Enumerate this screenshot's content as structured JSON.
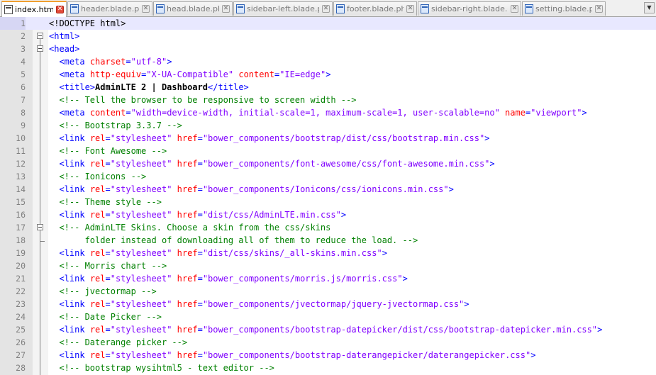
{
  "tabs": [
    {
      "label": "index.html",
      "active": true
    },
    {
      "label": "header.blade.php",
      "active": false
    },
    {
      "label": "head.blade.php",
      "active": false
    },
    {
      "label": "sidebar-left.blade.php",
      "active": false
    },
    {
      "label": "footer.blade.php",
      "active": false
    },
    {
      "label": "sidebar-right.blade.php",
      "active": false
    },
    {
      "label": "setting.blade.php",
      "active": false
    }
  ],
  "dropdown_icon": "chevron-down-icon",
  "colors": {
    "tag": "#0000ff",
    "attribute": "#ff0000",
    "value": "#8000ff",
    "comment": "#008000",
    "current_line": "#e8e8ff",
    "active_tab_accent": "#f0a030"
  },
  "editor": {
    "current_line": 1,
    "lines": [
      {
        "n": "1",
        "tokens": [
          [
            "doc",
            "<!DOCTYPE html>"
          ]
        ]
      },
      {
        "n": "2",
        "tokens": [
          [
            "tag",
            "<html>"
          ]
        ]
      },
      {
        "n": "3",
        "tokens": [
          [
            "tag",
            "<head>"
          ]
        ]
      },
      {
        "n": "4",
        "tokens": [
          [
            "pl",
            "  "
          ],
          [
            "tag",
            "<meta "
          ],
          [
            "attr",
            "charset"
          ],
          [
            "tag",
            "="
          ],
          [
            "val",
            "\"utf-8\""
          ],
          [
            "tag",
            ">"
          ]
        ]
      },
      {
        "n": "5",
        "tokens": [
          [
            "pl",
            "  "
          ],
          [
            "tag",
            "<meta "
          ],
          [
            "attr",
            "http-equiv"
          ],
          [
            "tag",
            "="
          ],
          [
            "val",
            "\"X-UA-Compatible\""
          ],
          [
            "tag",
            " "
          ],
          [
            "attr",
            "content"
          ],
          [
            "tag",
            "="
          ],
          [
            "val",
            "\"IE=edge\""
          ],
          [
            "tag",
            ">"
          ]
        ]
      },
      {
        "n": "6",
        "tokens": [
          [
            "pl",
            "  "
          ],
          [
            "tag",
            "<title>"
          ],
          [
            "txt",
            "AdminLTE 2 | Dashboard"
          ],
          [
            "tag",
            "</title>"
          ]
        ]
      },
      {
        "n": "7",
        "tokens": [
          [
            "pl",
            "  "
          ],
          [
            "com",
            "<!-- Tell the browser to be responsive to screen width -->"
          ]
        ]
      },
      {
        "n": "8",
        "tokens": [
          [
            "pl",
            "  "
          ],
          [
            "tag",
            "<meta "
          ],
          [
            "attr",
            "content"
          ],
          [
            "tag",
            "="
          ],
          [
            "val",
            "\"width=device-width, initial-scale=1, maximum-scale=1, user-scalable=no\""
          ],
          [
            "tag",
            " "
          ],
          [
            "attr",
            "name"
          ],
          [
            "tag",
            "="
          ],
          [
            "val",
            "\"viewport\""
          ],
          [
            "tag",
            ">"
          ]
        ]
      },
      {
        "n": "9",
        "tokens": [
          [
            "pl",
            "  "
          ],
          [
            "com",
            "<!-- Bootstrap 3.3.7 -->"
          ]
        ]
      },
      {
        "n": "10",
        "tokens": [
          [
            "pl",
            "  "
          ],
          [
            "tag",
            "<link "
          ],
          [
            "attr",
            "rel"
          ],
          [
            "tag",
            "="
          ],
          [
            "val",
            "\"stylesheet\""
          ],
          [
            "tag",
            " "
          ],
          [
            "attr",
            "href"
          ],
          [
            "tag",
            "="
          ],
          [
            "val",
            "\"bower_components/bootstrap/dist/css/bootstrap.min.css\""
          ],
          [
            "tag",
            ">"
          ]
        ]
      },
      {
        "n": "11",
        "tokens": [
          [
            "pl",
            "  "
          ],
          [
            "com",
            "<!-- Font Awesome -->"
          ]
        ]
      },
      {
        "n": "12",
        "tokens": [
          [
            "pl",
            "  "
          ],
          [
            "tag",
            "<link "
          ],
          [
            "attr",
            "rel"
          ],
          [
            "tag",
            "="
          ],
          [
            "val",
            "\"stylesheet\""
          ],
          [
            "tag",
            " "
          ],
          [
            "attr",
            "href"
          ],
          [
            "tag",
            "="
          ],
          [
            "val",
            "\"bower_components/font-awesome/css/font-awesome.min.css\""
          ],
          [
            "tag",
            ">"
          ]
        ]
      },
      {
        "n": "13",
        "tokens": [
          [
            "pl",
            "  "
          ],
          [
            "com",
            "<!-- Ionicons -->"
          ]
        ]
      },
      {
        "n": "14",
        "tokens": [
          [
            "pl",
            "  "
          ],
          [
            "tag",
            "<link "
          ],
          [
            "attr",
            "rel"
          ],
          [
            "tag",
            "="
          ],
          [
            "val",
            "\"stylesheet\""
          ],
          [
            "tag",
            " "
          ],
          [
            "attr",
            "href"
          ],
          [
            "tag",
            "="
          ],
          [
            "val",
            "\"bower_components/Ionicons/css/ionicons.min.css\""
          ],
          [
            "tag",
            ">"
          ]
        ]
      },
      {
        "n": "15",
        "tokens": [
          [
            "pl",
            "  "
          ],
          [
            "com",
            "<!-- Theme style -->"
          ]
        ]
      },
      {
        "n": "16",
        "tokens": [
          [
            "pl",
            "  "
          ],
          [
            "tag",
            "<link "
          ],
          [
            "attr",
            "rel"
          ],
          [
            "tag",
            "="
          ],
          [
            "val",
            "\"stylesheet\""
          ],
          [
            "tag",
            " "
          ],
          [
            "attr",
            "href"
          ],
          [
            "tag",
            "="
          ],
          [
            "val",
            "\"dist/css/AdminLTE.min.css\""
          ],
          [
            "tag",
            ">"
          ]
        ]
      },
      {
        "n": "17",
        "tokens": [
          [
            "pl",
            "  "
          ],
          [
            "com",
            "<!-- AdminLTE Skins. Choose a skin from the css/skins"
          ]
        ]
      },
      {
        "n": "18",
        "tokens": [
          [
            "com",
            "       folder instead of downloading all of them to reduce the load. -->"
          ]
        ]
      },
      {
        "n": "19",
        "tokens": [
          [
            "pl",
            "  "
          ],
          [
            "tag",
            "<link "
          ],
          [
            "attr",
            "rel"
          ],
          [
            "tag",
            "="
          ],
          [
            "val",
            "\"stylesheet\""
          ],
          [
            "tag",
            " "
          ],
          [
            "attr",
            "href"
          ],
          [
            "tag",
            "="
          ],
          [
            "val",
            "\"dist/css/skins/_all-skins.min.css\""
          ],
          [
            "tag",
            ">"
          ]
        ]
      },
      {
        "n": "20",
        "tokens": [
          [
            "pl",
            "  "
          ],
          [
            "com",
            "<!-- Morris chart -->"
          ]
        ]
      },
      {
        "n": "21",
        "tokens": [
          [
            "pl",
            "  "
          ],
          [
            "tag",
            "<link "
          ],
          [
            "attr",
            "rel"
          ],
          [
            "tag",
            "="
          ],
          [
            "val",
            "\"stylesheet\""
          ],
          [
            "tag",
            " "
          ],
          [
            "attr",
            "href"
          ],
          [
            "tag",
            "="
          ],
          [
            "val",
            "\"bower_components/morris.js/morris.css\""
          ],
          [
            "tag",
            ">"
          ]
        ]
      },
      {
        "n": "22",
        "tokens": [
          [
            "pl",
            "  "
          ],
          [
            "com",
            "<!-- jvectormap -->"
          ]
        ]
      },
      {
        "n": "23",
        "tokens": [
          [
            "pl",
            "  "
          ],
          [
            "tag",
            "<link "
          ],
          [
            "attr",
            "rel"
          ],
          [
            "tag",
            "="
          ],
          [
            "val",
            "\"stylesheet\""
          ],
          [
            "tag",
            " "
          ],
          [
            "attr",
            "href"
          ],
          [
            "tag",
            "="
          ],
          [
            "val",
            "\"bower_components/jvectormap/jquery-jvectormap.css\""
          ],
          [
            "tag",
            ">"
          ]
        ]
      },
      {
        "n": "24",
        "tokens": [
          [
            "pl",
            "  "
          ],
          [
            "com",
            "<!-- Date Picker -->"
          ]
        ]
      },
      {
        "n": "25",
        "tokens": [
          [
            "pl",
            "  "
          ],
          [
            "tag",
            "<link "
          ],
          [
            "attr",
            "rel"
          ],
          [
            "tag",
            "="
          ],
          [
            "val",
            "\"stylesheet\""
          ],
          [
            "tag",
            " "
          ],
          [
            "attr",
            "href"
          ],
          [
            "tag",
            "="
          ],
          [
            "val",
            "\"bower_components/bootstrap-datepicker/dist/css/bootstrap-datepicker.min.css\""
          ],
          [
            "tag",
            ">"
          ]
        ]
      },
      {
        "n": "26",
        "tokens": [
          [
            "pl",
            "  "
          ],
          [
            "com",
            "<!-- Daterange picker -->"
          ]
        ]
      },
      {
        "n": "27",
        "tokens": [
          [
            "pl",
            "  "
          ],
          [
            "tag",
            "<link "
          ],
          [
            "attr",
            "rel"
          ],
          [
            "tag",
            "="
          ],
          [
            "val",
            "\"stylesheet\""
          ],
          [
            "tag",
            " "
          ],
          [
            "attr",
            "href"
          ],
          [
            "tag",
            "="
          ],
          [
            "val",
            "\"bower_components/bootstrap-daterangepicker/daterangepicker.css\""
          ],
          [
            "tag",
            ">"
          ]
        ]
      },
      {
        "n": "28",
        "tokens": [
          [
            "pl",
            "  "
          ],
          [
            "com",
            "<!-- bootstrap wysihtml5 - text editor -->"
          ]
        ]
      }
    ]
  }
}
